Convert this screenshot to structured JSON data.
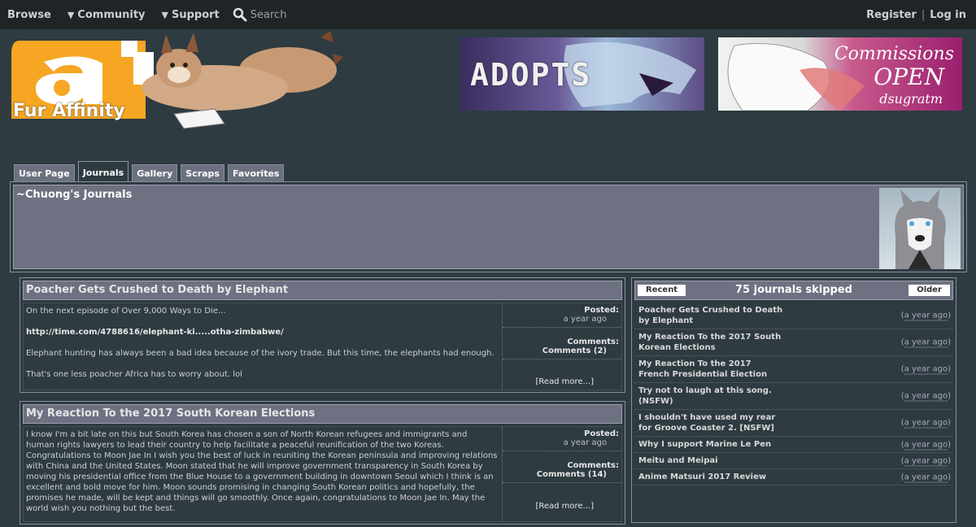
{
  "nav": {
    "browse": "Browse",
    "community": "Community",
    "support": "Support",
    "search_placeholder": "Search",
    "register": "Register",
    "separator": "|",
    "login": "Log in"
  },
  "logo": {
    "text": "Fur Affinity",
    "letter": "a"
  },
  "banners": {
    "left_text": "ADOPTS",
    "right_line1": "Commissions",
    "right_line2": "OPEN",
    "right_line3": "dsugratm"
  },
  "tabs": [
    "User Page",
    "Journals",
    "Gallery",
    "Scraps",
    "Favorites"
  ],
  "user": {
    "title": "~Chuong's Journals"
  },
  "entries": [
    {
      "title": "Poacher Gets Crushed to Death by Elephant",
      "p1": "On the next episode of Over 9,000 Ways to Die...",
      "link": "http://time.com/4788616/elephant-ki.....otha-zimbabwe/",
      "p2": "Elephant hunting has always been a bad idea because of the ivory trade. But this time, the elephants had enough.",
      "p3": "That's one less poacher Africa has to worry about. lol",
      "posted_label": "Posted:",
      "posted": "a year ago",
      "comments_label": "Comments:",
      "comments": "Comments (2)",
      "readmore": "[Read more...]"
    },
    {
      "title": "My Reaction To the 2017 South Korean Elections",
      "p1": "I know I'm a bit late on this but South Korea has chosen a son of North Korean refugees and immigrants and human rights lawyers to lead their country to help facilitate a peaceful reunification of the two Koreas. Congratulations to Moon Jae In I wish you the best of luck in reuniting the Korean peninsula and improving relations with China and the United States. Moon stated that he will improve government transparency in South Korea by moving his presidential office from the Blue House to a government building in downtown Seoul which I think is an excellent and bold move for him. Moon sounds promising in changing South Korean politics and hopefully, the promises he made, will be kept and things will go smoothly. Once again, congratulations to Moon Jae In. May the world wish you nothing but the best.",
      "posted_label": "Posted:",
      "posted": "a year ago",
      "comments_label": "Comments:",
      "comments": "Comments (14)",
      "readmore": "[Read more...]"
    }
  ],
  "sidebar": {
    "recent": "Recent",
    "header": "75 journals skipped",
    "older": "Older",
    "items": [
      {
        "title": "Poacher Gets Crushed to Death by Elephant",
        "date": "a year ago"
      },
      {
        "title": "My Reaction To the 2017 South Korean Elections",
        "date": "a year ago"
      },
      {
        "title": "My Reaction To the 2017 French Presidential Election",
        "date": "a year ago"
      },
      {
        "title": "Try not to laugh at this song. (NSFW)",
        "date": "a year ago"
      },
      {
        "title": "I shouldn't have used my rear for Groove Coaster 2. [NSFW]",
        "date": "a year ago"
      },
      {
        "title": "Why I support Marine Le Pen",
        "date": "a year ago"
      },
      {
        "title": "Meitu and Meipai",
        "date": "a year ago"
      },
      {
        "title": "Anime Matsuri 2017 Review",
        "date": "a year ago"
      }
    ]
  }
}
